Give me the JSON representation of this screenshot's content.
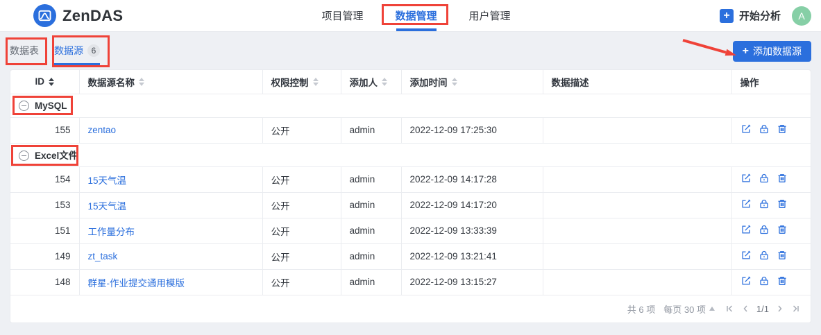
{
  "brand": {
    "name": "ZenDAS"
  },
  "navbar": {
    "items": [
      {
        "label": "项目管理",
        "active": false
      },
      {
        "label": "数据管理",
        "active": true
      },
      {
        "label": "用户管理",
        "active": false
      }
    ],
    "start_analysis_label": "开始分析",
    "avatar_letter": "A"
  },
  "tabs": {
    "items": [
      {
        "label": "数据表",
        "active": false
      },
      {
        "label": "数据源",
        "badge": "6",
        "active": true
      }
    ],
    "add_button_label": "添加数据源"
  },
  "table": {
    "columns": [
      {
        "key": "id",
        "label": "ID",
        "sortable": true,
        "active_sort": true
      },
      {
        "key": "name",
        "label": "数据源名称",
        "sortable": true,
        "active_sort": false
      },
      {
        "key": "permission",
        "label": "权限控制",
        "sortable": true,
        "active_sort": false
      },
      {
        "key": "adder",
        "label": "添加人",
        "sortable": true,
        "active_sort": false
      },
      {
        "key": "added-time",
        "label": "添加时间",
        "sortable": true,
        "active_sort": false
      },
      {
        "key": "description",
        "label": "数据描述",
        "sortable": false,
        "active_sort": false
      },
      {
        "key": "actions",
        "label": "操作",
        "sortable": false,
        "active_sort": false
      }
    ],
    "groups": [
      {
        "name": "MySQL",
        "rows": [
          {
            "id": "155",
            "name": "zentao",
            "permission": "公开",
            "adder": "admin",
            "added_time": "2022-12-09 17:25:30",
            "description": ""
          }
        ]
      },
      {
        "name": "Excel文件",
        "rows": [
          {
            "id": "154",
            "name": "15天气温",
            "permission": "公开",
            "adder": "admin",
            "added_time": "2022-12-09 14:17:28",
            "description": ""
          },
          {
            "id": "153",
            "name": "15天气温",
            "permission": "公开",
            "adder": "admin",
            "added_time": "2022-12-09 14:17:20",
            "description": ""
          },
          {
            "id": "151",
            "name": "工作量分布",
            "permission": "公开",
            "adder": "admin",
            "added_time": "2022-12-09 13:33:39",
            "description": ""
          },
          {
            "id": "149",
            "name": "zt_task",
            "permission": "公开",
            "adder": "admin",
            "added_time": "2022-12-09 13:21:41",
            "description": ""
          },
          {
            "id": "148",
            "name": "群星-作业提交通用模版",
            "permission": "公开",
            "adder": "admin",
            "added_time": "2022-12-09 13:15:27",
            "description": ""
          }
        ]
      }
    ]
  },
  "footer": {
    "total": "共 6 项",
    "per_page": "每页 30 项",
    "page": "1/1"
  },
  "icons": {
    "logo": "bell-curve-chart-icon",
    "start_analysis": "plus-icon",
    "tab_count": "count-badge",
    "group_toggle": "circle-minus-icon",
    "sort": "sort-carets-icon",
    "row_actions": [
      "edit-icon",
      "lock-icon",
      "trash-icon"
    ],
    "pagination": [
      "first-page-icon",
      "prev-page-icon",
      "next-page-icon",
      "last-page-icon"
    ],
    "annotations": [
      "red-box",
      "red-arrow"
    ]
  },
  "colors": {
    "primary": "#2b6fdd",
    "annotation_red": "#ef4238",
    "avatar_green": "#86cfa6",
    "link_blue": "#2b6fdd"
  }
}
